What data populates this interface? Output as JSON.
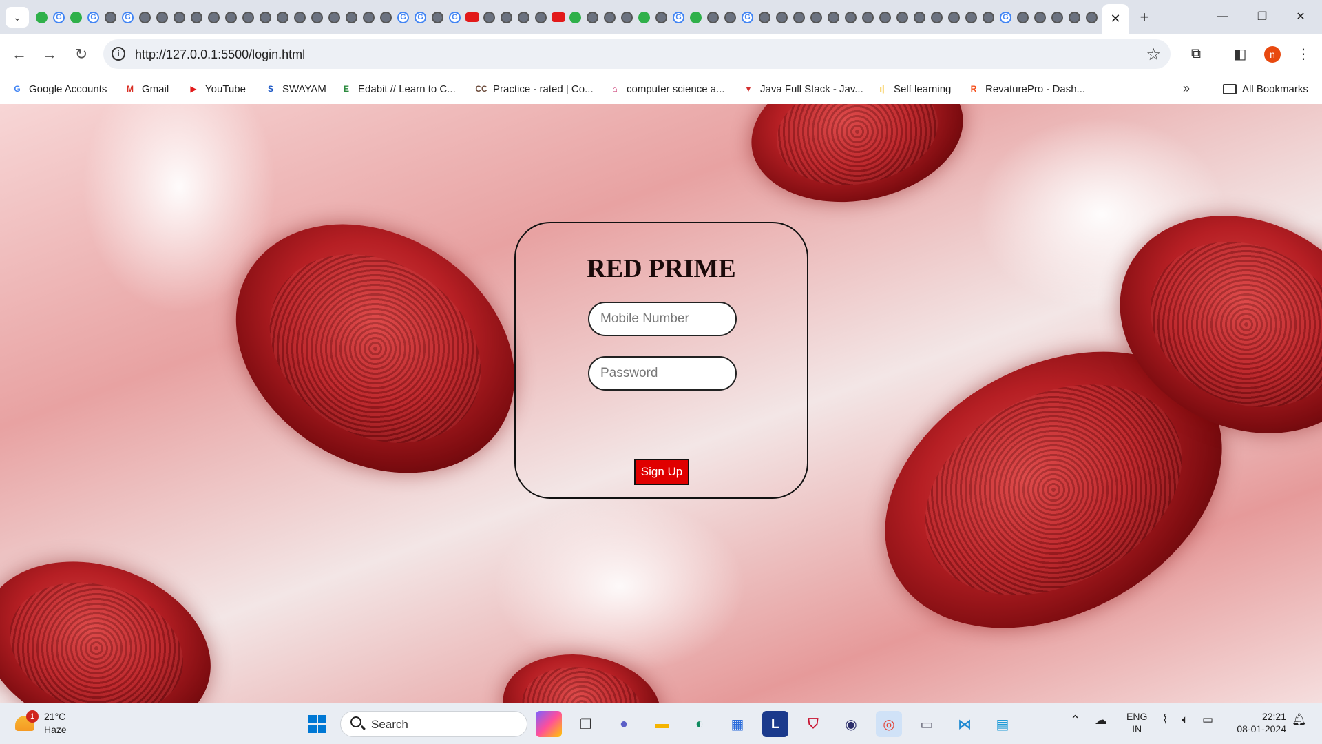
{
  "browser": {
    "favicon_strip": [
      "grn",
      "g",
      "grn",
      "g",
      "globe",
      "g",
      "globe",
      "globe",
      "globe",
      "globe",
      "globe",
      "globe",
      "globe",
      "globe",
      "globe",
      "globe",
      "globe",
      "globe",
      "globe",
      "globe",
      "globe",
      "g",
      "g",
      "globe",
      "g",
      "yt",
      "globe",
      "globe",
      "globe",
      "globe",
      "yt",
      "grn",
      "globe",
      "globe",
      "globe",
      "grn",
      "globe",
      "g",
      "grn",
      "globe",
      "globe",
      "g",
      "globe",
      "globe",
      "globe",
      "globe",
      "globe",
      "globe",
      "globe",
      "globe",
      "globe",
      "globe",
      "globe",
      "globe",
      "globe",
      "globe",
      "g",
      "globe",
      "globe",
      "globe",
      "globe",
      "globe",
      "g",
      "globe"
    ],
    "close_tab_glyph": "✕",
    "new_tab_glyph": "+",
    "url": "http://127.0.0.1:5500/login.html",
    "profile_initial": "n"
  },
  "bookmarks": [
    {
      "label": "Google Accounts",
      "icon": "G",
      "color": "#4285f4"
    },
    {
      "label": "Gmail",
      "icon": "M",
      "color": "#d93025"
    },
    {
      "label": "YouTube",
      "icon": "▶",
      "color": "#e21a1a"
    },
    {
      "label": "SWAYAM",
      "icon": "S",
      "color": "#1a56c4"
    },
    {
      "label": "Edabit // Learn to C...",
      "icon": "E",
      "color": "#2b8a3e"
    },
    {
      "label": "Practice - rated | Co...",
      "icon": "CC",
      "color": "#6b4a3a"
    },
    {
      "label": "computer science a...",
      "icon": "⌂",
      "color": "#c2185b"
    },
    {
      "label": "Java Full Stack - Jav...",
      "icon": "▼",
      "color": "#d32f2f"
    },
    {
      "label": "Self learning",
      "icon": "ı|",
      "color": "#f5b400"
    },
    {
      "label": "RevaturePro - Dash...",
      "icon": "R",
      "color": "#f4511e"
    }
  ],
  "all_bookmarks_label": "All Bookmarks",
  "login": {
    "title": "RED PRIME",
    "mobile_placeholder": "Mobile Number",
    "password_placeholder": "Password",
    "signup_label": "Sign Up"
  },
  "taskbar": {
    "weather_badge": "1",
    "temperature": "21°C",
    "condition": "Haze",
    "search_label": "Search",
    "lang_top": "ENG",
    "lang_bottom": "IN",
    "time": "22:21",
    "date": "08-01-2024"
  }
}
